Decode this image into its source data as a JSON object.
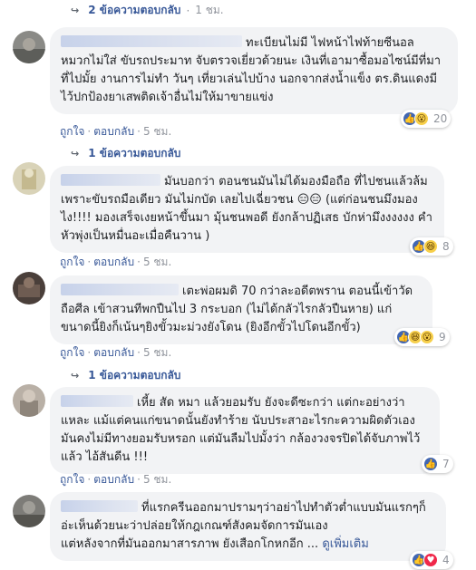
{
  "top_reply": {
    "label": "2 ข้อความตอบกลับ",
    "time": "1 ชม."
  },
  "comments": [
    {
      "text": "ทะเบียนไม่มี ไฟหน้าไฟท้ายซีนอล หมวกไม่ใส่ ขับรถประมาท จับตรวจเยี่ยวด้วยนะ เงินที่เอามาซื้อมอไซน์มีที่มาที่ไปมั้ย งานการไม่ทำ วันๆ เที่ยวเล่นไปบ้าง นอกจากส่งน้ำแข็ง ตร.ดินแดงมีไว้ปกป้องยาเสพติดเจ้าอื่นไม่ให้มาขายแข่ง",
      "reactions": [
        "like",
        "wow"
      ],
      "count": "20",
      "like": "ถูกใจ",
      "reply": "ตอบกลับ",
      "time": "5 ชม.",
      "replies": "1 ข้อความตอบกลับ"
    },
    {
      "text": "มันบอกว่า ตอนชนมันไม่ได้มองมือถือ ที่ไปชนแล้วล้มเพราะขับรถมือเดียว มันไม่กบัด เลยไปเฉี่ยวชน 😑😑 (แต่ก่อนชนมึงมองไง!!!! มองเสร็จเงยหน้าขึ้นมา มุ้นชนพอดี ยังกล้าปฏิเสธ บักห่ามึงงงงงง คำหัวพุ่งเป็นหมื่นอะเมื่อคืนวาน )",
      "reactions": [
        "like",
        "haha"
      ],
      "count": "8",
      "like": "ถูกใจ",
      "reply": "ตอบกลับ",
      "time": "5 ชม."
    },
    {
      "text": "เตะพ่อผมดิ 70 กว่าละอดีตพราน ตอนนี้เข้าวัดถือศีล เข้าสวนทีพกปืนไป 3 กระบอก (ไม่ได้กลัวไรกลัวปืนหาย) แก่ขนาดนี้ยิงก็เน้นๆยิงขั้วมะม่วงยังโดน (ยิงอีกขั้วไปโดนอีกขั้ว)",
      "reactions": [
        "like",
        "haha",
        "wow"
      ],
      "count": "9",
      "like": "ถูกใจ",
      "reply": "ตอบกลับ",
      "time": "5 ชม.",
      "replies": "1 ข้อความตอบกลับ"
    },
    {
      "text": "เหี้ย สัด หมา แล้วยอมรับ ยังจะดีซะกว่า แต่กะอย่างว่าแหละ แม้แต่คนแก่ขนาดนั้นยังทำร้าย นับประสาอะไรกะความผิดตัวเองมันคงไม่มีทางยอมรับหรอก แต่มันลืมไปมั้งว่า กล้องวงจรปิดได้จับภาพไว้แล้ว ไอ้สันดีน !!!",
      "reactions": [
        "like"
      ],
      "count": "7",
      "like": "ถูกใจ",
      "reply": "ตอบกลับ",
      "time": "5 ชม."
    },
    {
      "text": "ที่แรกครีนออกมาปรามๆว่าอย่าไปทำตัวต่ำแบบมันแรกๆก็อ่ะเห็นด้วยนะว่าปล่อยให้กฎเกณฑ์สังคมจัดการมันเอง\nแต่หลังจากที่มันออกมาสารภาพ ยังเสือกโกหกอีก ...",
      "more": "ดูเพิ่มเติม",
      "reactions": [
        "like",
        "love"
      ],
      "count": "4"
    }
  ]
}
